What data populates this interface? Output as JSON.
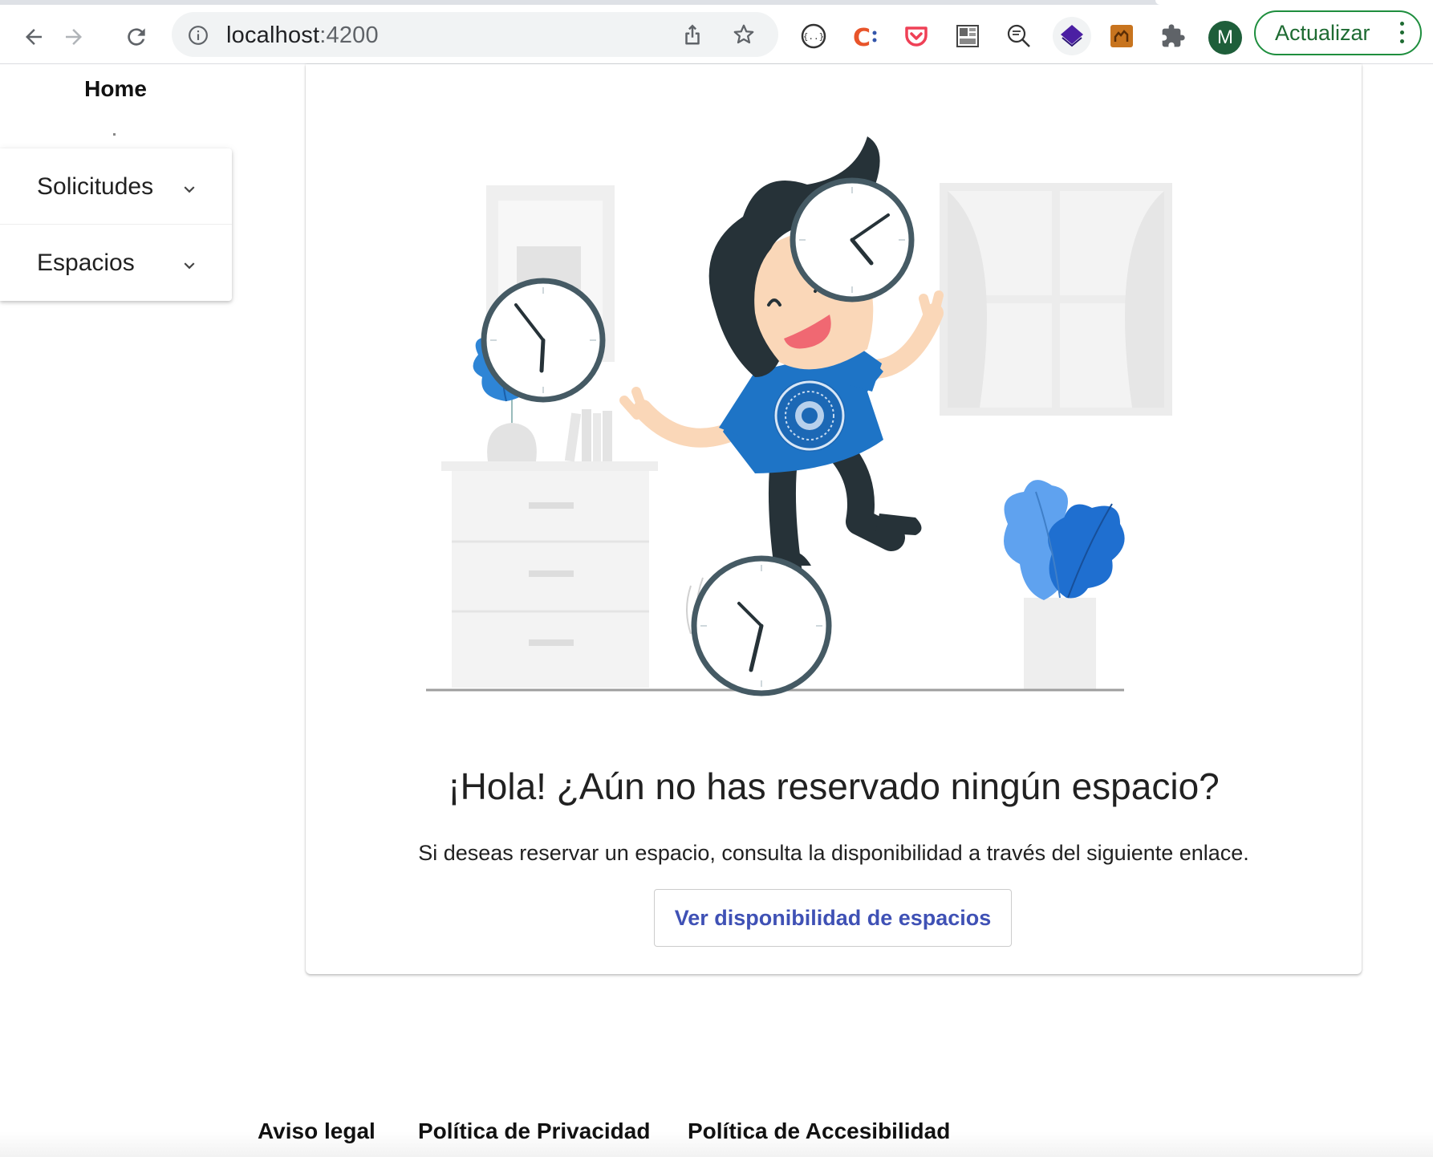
{
  "browser": {
    "url_host": "localhost",
    "url_port": ":4200",
    "update_label": "Actualizar",
    "profile_initial": "M"
  },
  "sidebar": {
    "home_label": "Home",
    "items": [
      {
        "label": "Solicitudes"
      },
      {
        "label": "Espacios"
      }
    ]
  },
  "main": {
    "headline": "¡Hola! ¿Aún no has reservado ningún espacio?",
    "subline": "Si deseas reservar un espacio, consulta la disponibilidad a través del siguiente enlace.",
    "cta_label": "Ver disponibilidad de espacios"
  },
  "footer": {
    "links": [
      {
        "label": "Aviso legal"
      },
      {
        "label": "Política de Privacidad"
      },
      {
        "label": "Política de Accesibilidad"
      }
    ]
  },
  "colors": {
    "accent": "#3f51b5",
    "shirt": "#1e74c6",
    "update_green": "#1e8e3e"
  }
}
